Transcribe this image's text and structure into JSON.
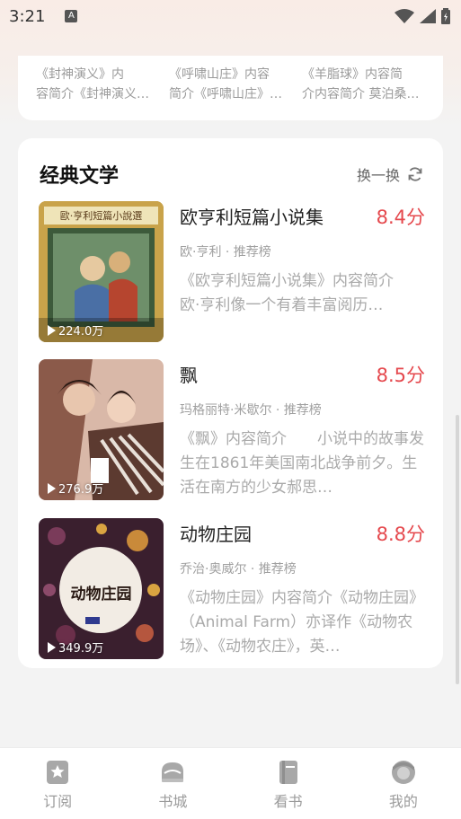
{
  "status": {
    "time": "3:21",
    "notif_icon": "A"
  },
  "top_card": {
    "columns": [
      {
        "line1": "《封神演义》内",
        "line2": "容简介《封神演义…"
      },
      {
        "line1": "《呼啸山庄》内容",
        "line2": "简介《呼啸山庄》…"
      },
      {
        "line1": "《羊脂球》内容简",
        "line2": "介内容简介 莫泊桑…"
      }
    ]
  },
  "section": {
    "title": "经典文学",
    "refresh_label": "换一换"
  },
  "books": [
    {
      "title": "欧亨利短篇小说集",
      "score": "8.4分",
      "meta": "欧·亨利 · 推荐榜",
      "desc": "《欧亨利短篇小说集》内容简介　　欧·亨利像一个有着丰富阅历…",
      "views": "224.0万",
      "cover_text": "歐·亨利短篇小說選",
      "cover_color": "#c9a34a"
    },
    {
      "title": "飘",
      "score": "8.5分",
      "meta": "玛格丽特·米歇尔 · 推荐榜",
      "desc": "《飘》内容简介　　小说中的故事发生在1861年美国南北战争前夕。生活在南方的少女郝思…",
      "views": "276.9万",
      "cover_color": "#8b5a4a"
    },
    {
      "title": "动物庄园",
      "score": "8.8分",
      "meta": "乔治·奥威尔 · 推荐榜",
      "desc": "《动物庄园》内容简介《动物庄园》（Animal Farm）亦译作《动物农场》、《动物农庄》，英…",
      "views": "349.9万",
      "cover_text": "动物庄园",
      "cover_color": "#3a1f2e"
    }
  ],
  "nav": [
    {
      "label": "订阅",
      "icon": "star-bookmark-icon"
    },
    {
      "label": "书城",
      "icon": "bookstore-icon"
    },
    {
      "label": "看书",
      "icon": "book-icon"
    },
    {
      "label": "我的",
      "icon": "profile-icon"
    }
  ]
}
